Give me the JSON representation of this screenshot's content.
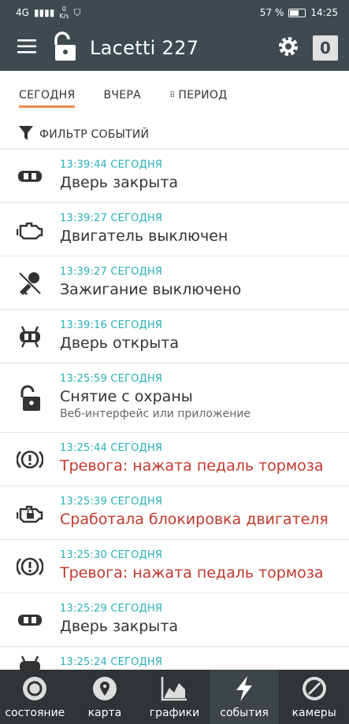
{
  "status": {
    "signal": "4G",
    "speed_value": "0",
    "speed_unit": "K/s",
    "battery": "57 %",
    "time": "14:25"
  },
  "app": {
    "title": "Lacetti 227",
    "counter": "0"
  },
  "tabs": [
    {
      "label": "СЕГОДНЯ"
    },
    {
      "label": "ВЧЕРА"
    },
    {
      "label": "ПЕРИОД"
    }
  ],
  "filter": {
    "label": "ФИЛЬТР СОБЫТИЙ"
  },
  "events": [
    {
      "time": "13:39:44 СЕГОДНЯ",
      "label": "Дверь закрыта",
      "icon": "car-icon"
    },
    {
      "time": "13:39:27 СЕГОДНЯ",
      "label": "Двигатель выключен",
      "icon": "engine-icon"
    },
    {
      "time": "13:39:27 СЕГОДНЯ",
      "label": "Зажигание выключено",
      "icon": "key-off-icon"
    },
    {
      "time": "13:39:16 СЕГОДНЯ",
      "label": "Дверь открыта",
      "icon": "car-doors-open-icon"
    },
    {
      "time": "13:25:59 СЕГОДНЯ",
      "label": "Снятие с охраны",
      "sub": "Веб-интерфейс или приложение",
      "icon": "unlock-icon"
    },
    {
      "time": "13:25:44 СЕГОДНЯ",
      "label": "Тревога: нажата педаль тормоза",
      "icon": "brake-alert-icon",
      "alarm": true
    },
    {
      "time": "13:25:39 СЕГОДНЯ",
      "label": "Сработала блокировка двигателя",
      "icon": "engine-lock-icon",
      "alarm": true
    },
    {
      "time": "13:25:30 СЕГОДНЯ",
      "label": "Тревога: нажата педаль тормоза",
      "icon": "brake-alert-icon",
      "alarm": true
    },
    {
      "time": "13:25:29 СЕГОДНЯ",
      "label": "Дверь закрыта",
      "icon": "car-icon"
    },
    {
      "time": "13:25:24 СЕГОДНЯ",
      "label": "",
      "icon": "car-doors-open-icon"
    }
  ],
  "nav": [
    {
      "label": "состояние",
      "icon": "status-icon"
    },
    {
      "label": "карта",
      "icon": "map-pin-icon"
    },
    {
      "label": "графики",
      "icon": "chart-icon"
    },
    {
      "label": "события",
      "icon": "lightning-icon",
      "active": true
    },
    {
      "label": "камеры",
      "icon": "camera-icon"
    }
  ],
  "colors": {
    "appbar": "#3e4a50",
    "accent": "#e88a4e",
    "time": "#2bb0b8",
    "alarm": "#c0392b"
  }
}
